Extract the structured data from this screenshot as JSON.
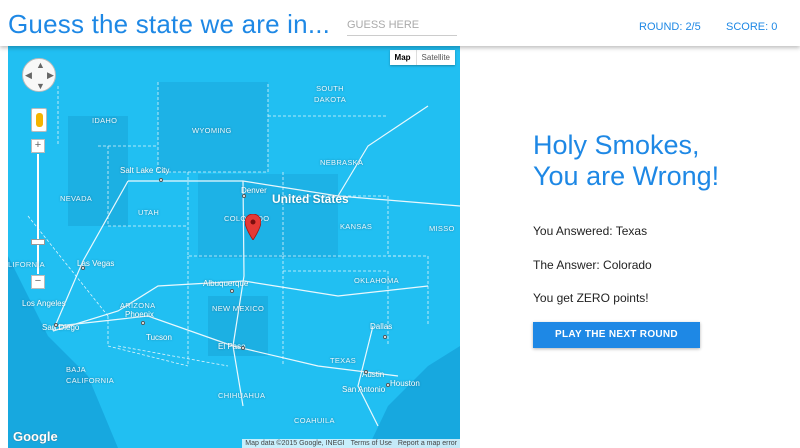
{
  "header": {
    "title": "Guess the state we are in...",
    "guess_placeholder": "GUESS HERE",
    "round": "ROUND: 2/5",
    "score": "SCORE: 0"
  },
  "map": {
    "type_buttons": [
      "Map",
      "Satellite"
    ],
    "google_logo": "Google",
    "attribution": [
      "Map data ©2015 Google, INEGI",
      "Terms of Use",
      "Report a map error"
    ],
    "zoom_in": "+",
    "zoom_out": "−",
    "labels": {
      "country": "United States",
      "idaho": "IDAHO",
      "wyoming": "WYOMING",
      "south_dakota": "SOUTH DAKOTA",
      "nebraska": "NEBRASKA",
      "nevada": "NEVADA",
      "utah": "UTAH",
      "colorado": "COLORADO",
      "kansas": "KANSAS",
      "missouri": "MISSO",
      "california": "LIFORNIA",
      "oklahoma": "OKLAHOMA",
      "arizona": "ARIZONA",
      "new_mexico": "NEW MEXICO",
      "texas": "TEXAS",
      "baja_california": "BAJA CALIFORNIA",
      "chihuahua": "CHIHUAHUA",
      "coahuila": "COAHUILA",
      "salt_lake_city": "Salt Lake City",
      "denver": "Denver",
      "las_vegas": "Las Vegas",
      "los_angeles": "Los Angeles",
      "san_diego": "San Diego",
      "phoenix": "Phoenix",
      "tucson": "Tucson",
      "albuquerque": "Albuquerque",
      "el_paso": "El Paso",
      "dallas": "Dallas",
      "austin": "Austin",
      "san_antonio": "San Antonio",
      "houston": "Houston"
    },
    "colors": {
      "water": "#21bff2",
      "land_dark": "#1ba6d8",
      "marker": "#e53935"
    }
  },
  "result": {
    "headline_1": "Holy Smokes,",
    "headline_2": "You are Wrong!",
    "answered": "You Answered: Texas",
    "answer": "The Answer: Colorado",
    "points": "You get ZERO points!",
    "button": "PLAY THE NEXT ROUND"
  },
  "colors": {
    "accent": "#1e88e5"
  }
}
